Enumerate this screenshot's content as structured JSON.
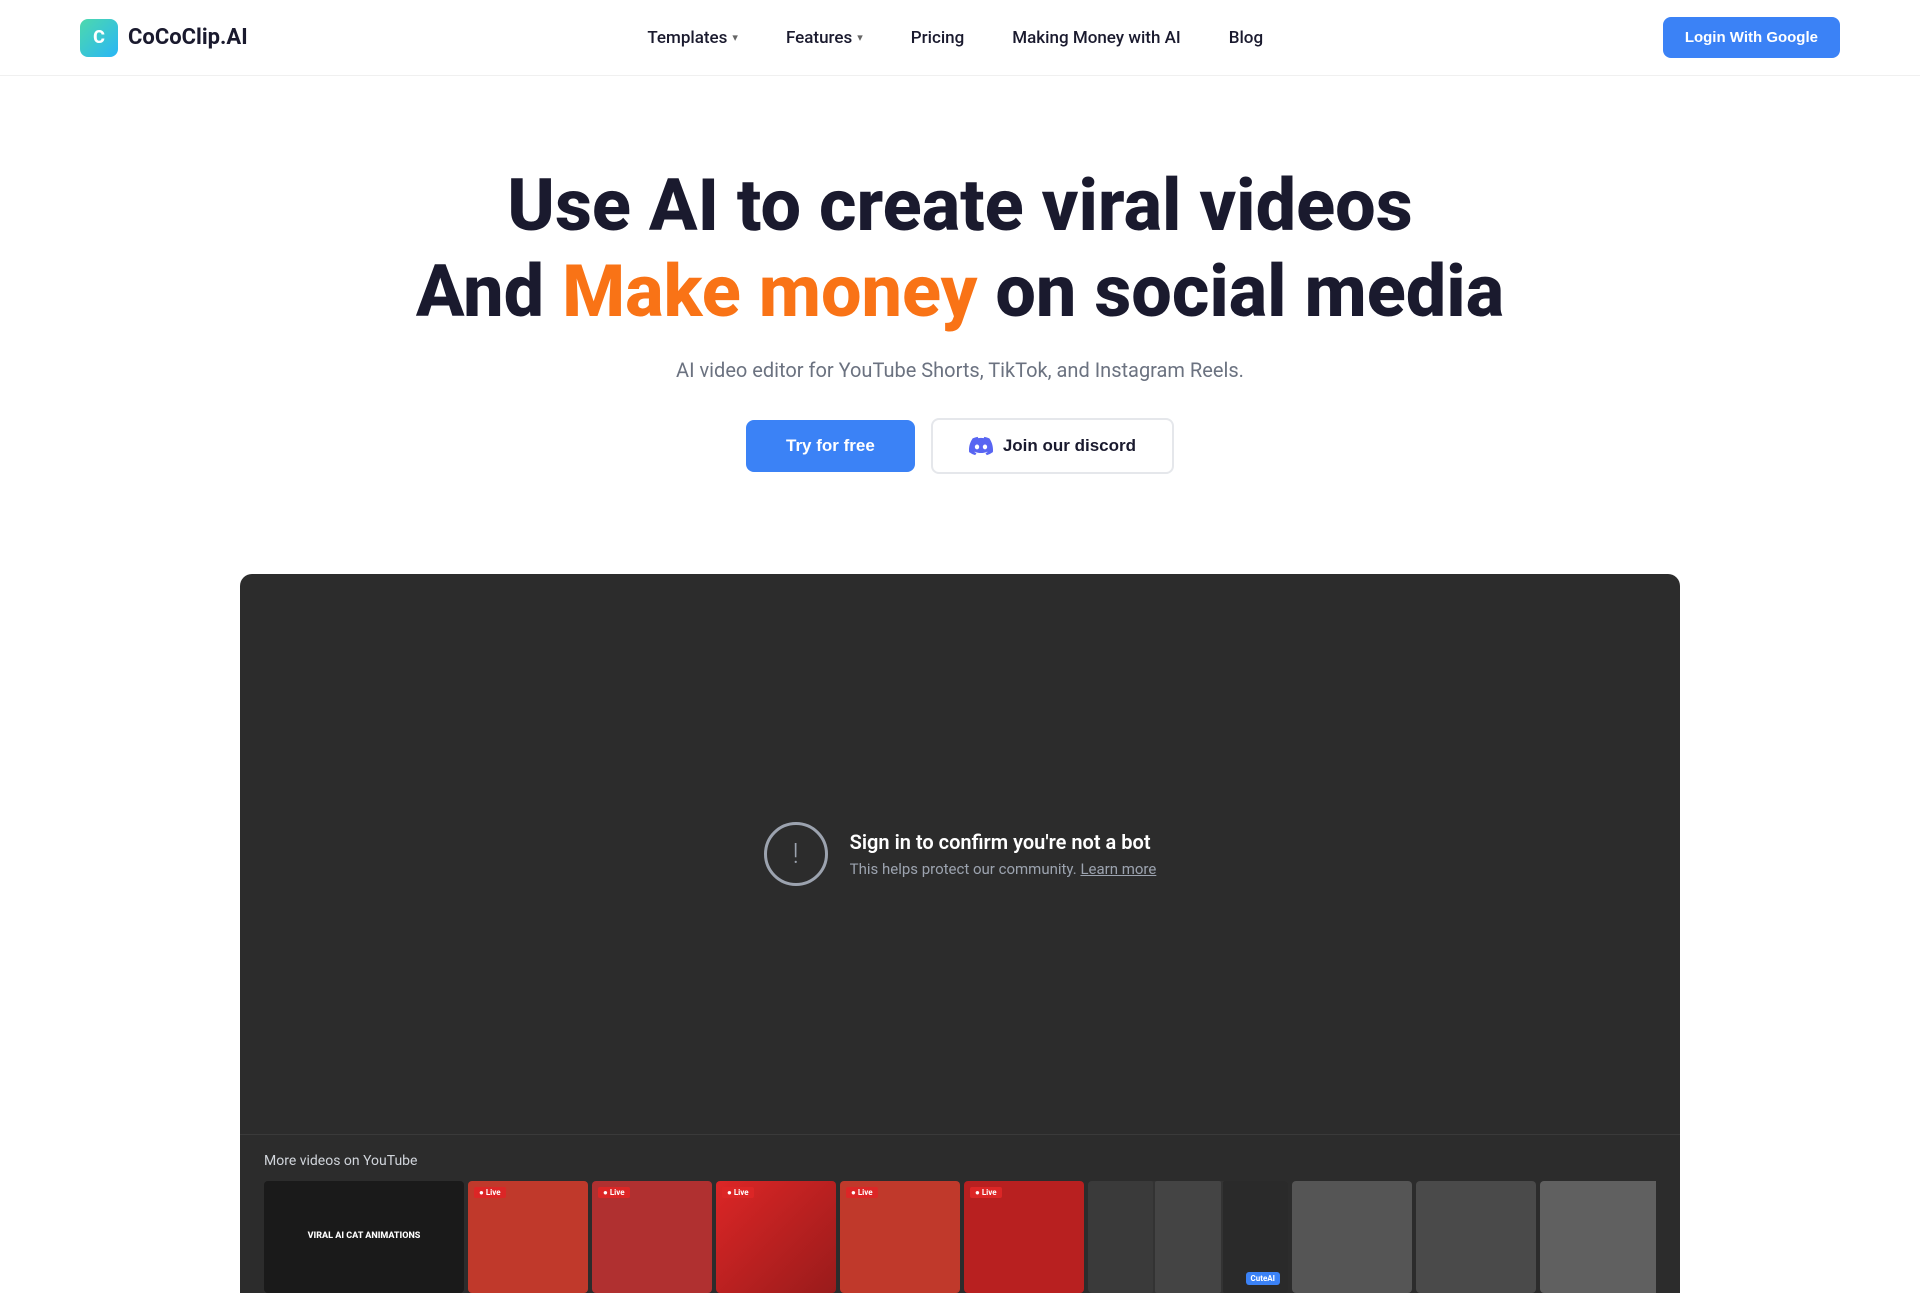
{
  "brand": {
    "logo_letter": "C",
    "name": "CoCoClip.AI",
    "url": "#"
  },
  "nav": {
    "links": [
      {
        "id": "templates",
        "label": "Templates",
        "has_dropdown": true
      },
      {
        "id": "features",
        "label": "Features",
        "has_dropdown": true
      },
      {
        "id": "pricing",
        "label": "Pricing",
        "has_dropdown": false
      },
      {
        "id": "making-money",
        "label": "Making Money with AI",
        "has_dropdown": false
      },
      {
        "id": "blog",
        "label": "Blog",
        "has_dropdown": false
      }
    ],
    "login_button": "Login With Google"
  },
  "hero": {
    "title_line1": "Use AI to create viral videos",
    "title_line2_before": "And ",
    "title_highlight": "Make money",
    "title_line2_after": " on social media",
    "subtitle": "AI video editor for YouTube Shorts, TikTok, and Instagram Reels.",
    "cta_primary": "Try for free",
    "cta_secondary": "Join our discord"
  },
  "video_section": {
    "bot_warning_title": "Sign in to confirm you're not a bot",
    "bot_warning_text": "This helps protect our community.",
    "learn_more": "Learn more"
  },
  "youtube_section": {
    "label": "More videos on YouTube",
    "thumbnails": [
      {
        "type": "cat",
        "title": "VIRAL AI CAT ANIMATIONS"
      },
      {
        "type": "live",
        "label": "Live"
      },
      {
        "type": "live",
        "label": "Live"
      },
      {
        "type": "live",
        "label": "Live"
      },
      {
        "type": "live",
        "label": "Live"
      },
      {
        "type": "live",
        "label": "Live"
      },
      {
        "type": "cutai",
        "badge": "CuteAI"
      },
      {
        "type": "gray"
      },
      {
        "type": "gray"
      },
      {
        "type": "gray"
      }
    ]
  },
  "colors": {
    "accent_blue": "#3b82f6",
    "accent_orange": "#f97316",
    "dark_bg": "#2c2c2c",
    "text_dark": "#1a1a2e",
    "text_gray": "#6b7280"
  }
}
